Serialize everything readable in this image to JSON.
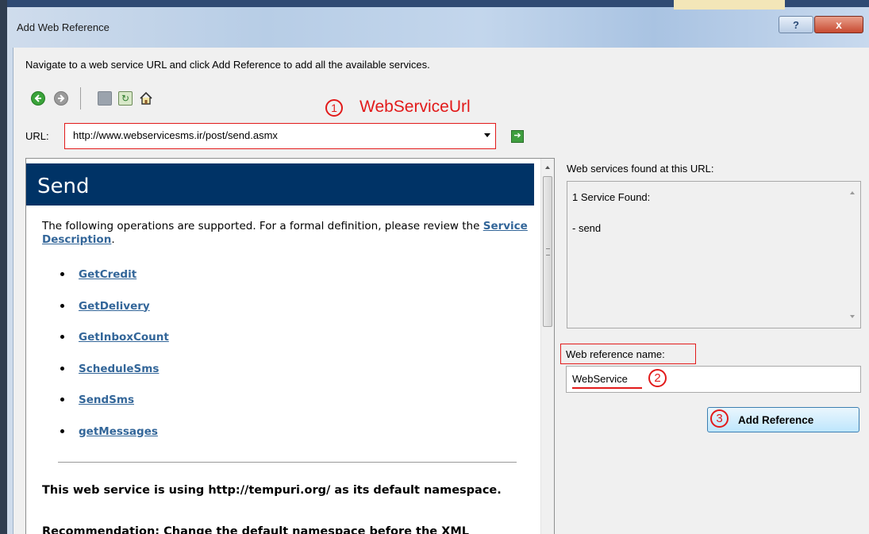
{
  "window": {
    "title": "Add Web Reference",
    "help_glyph": "?",
    "close_glyph": "x"
  },
  "instructions": "Navigate to a web service URL and click Add Reference to add all the available services.",
  "toolbar": {
    "icons": [
      "back-icon",
      "forward-icon",
      "stop-icon",
      "refresh-icon",
      "home-icon"
    ]
  },
  "url": {
    "label": "URL:",
    "value": "http://www.webservicesms.ir/post/send.asmx"
  },
  "annotations": {
    "step1": "1",
    "step1_text": "WebServiceUrl",
    "step2": "2",
    "step3": "3",
    "color": "#e21a1a"
  },
  "page": {
    "heading": "Send",
    "description_prefix": "The following operations are supported. For a formal definition, please review the ",
    "description_link": "Service Description",
    "description_suffix": ".",
    "operations": [
      "GetCredit",
      "GetDelivery",
      "GetInboxCount",
      "ScheduleSms",
      "SendSms",
      "getMessages"
    ],
    "namespace_text": "This web service is using http://tempuri.org/ as its default namespace.",
    "recommendation_text": "Recommendation: Change the default namespace before the XML",
    "banner_color": "#003366",
    "link_color": "#336699"
  },
  "services": {
    "label": "Web services found at this URL:",
    "count_text": "1 Service Found:",
    "items": [
      "- send"
    ]
  },
  "reference": {
    "label": "Web reference name:",
    "value": "WebService",
    "button_label": "Add Reference"
  }
}
